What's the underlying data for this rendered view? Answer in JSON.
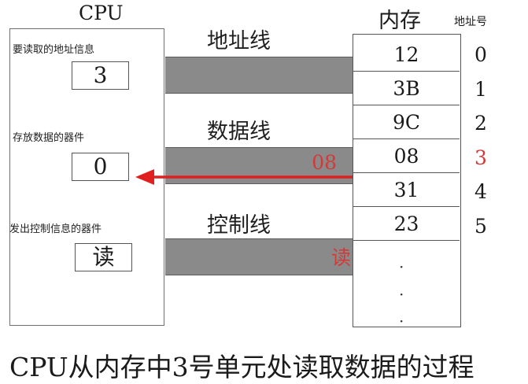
{
  "cpu": {
    "title": "CPU",
    "address_source_label": "要读取的地址信息",
    "address_value": "3",
    "data_store_label": "存放数据的器件",
    "data_value": "0",
    "control_label": "发出控制信息的器件",
    "control_value": "读"
  },
  "buses": {
    "address_label": "地址线",
    "data_label": "数据线",
    "data_value": "08",
    "control_label": "控制线",
    "control_value": "读"
  },
  "memory": {
    "title": "内存",
    "address_header": "地址号",
    "cells": [
      {
        "value": "12",
        "address": "0"
      },
      {
        "value": "3B",
        "address": "1"
      },
      {
        "value": "9C",
        "address": "2"
      },
      {
        "value": "08",
        "address": "3"
      },
      {
        "value": "31",
        "address": "4"
      },
      {
        "value": "23",
        "address": "5"
      }
    ],
    "ellipsis": [
      "·",
      "·",
      "·"
    ]
  },
  "caption": "CPU从内存中3号单元处读取数据的过程",
  "colors": {
    "bus": "#8a8a8a",
    "highlight": "#d23a3a",
    "arrow": "#e02020"
  }
}
